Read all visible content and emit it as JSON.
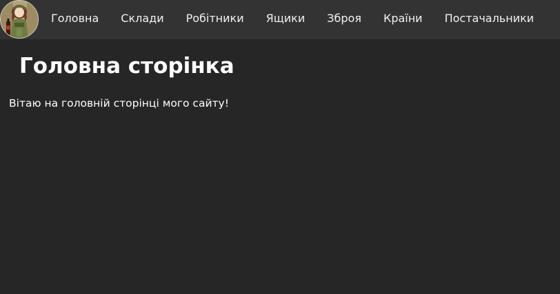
{
  "nav": {
    "logo": "avatar-logo",
    "items": [
      {
        "label": "Головна"
      },
      {
        "label": "Склади"
      },
      {
        "label": "Робітники"
      },
      {
        "label": "Ящики"
      },
      {
        "label": "Зброя"
      },
      {
        "label": "Країни"
      },
      {
        "label": "Постачальники"
      }
    ]
  },
  "main": {
    "title": "Головна сторінка",
    "welcome_text": "Вітаю на головній сторінці мого сайту!"
  },
  "colors": {
    "navbar_bg": "#333333",
    "page_bg": "#262626",
    "text": "#ffffff"
  }
}
